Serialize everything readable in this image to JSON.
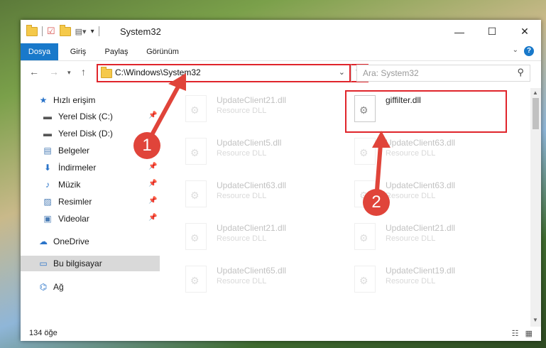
{
  "window": {
    "title": "System32"
  },
  "ribbon": {
    "tabs": [
      "Dosya",
      "Giriş",
      "Paylaş",
      "Görünüm"
    ]
  },
  "address": {
    "path": "C:\\Windows\\System32",
    "search_placeholder": "Ara: System32"
  },
  "sidebar": {
    "items": [
      {
        "label": "Hızlı erişim",
        "icon": "star-icon",
        "pinned": false
      },
      {
        "label": "Yerel Disk (C:)",
        "icon": "drive-icon",
        "pinned": true
      },
      {
        "label": "Yerel Disk (D:)",
        "icon": "drive-icon",
        "pinned": false
      },
      {
        "label": "Belgeler",
        "icon": "documents-icon",
        "pinned": true
      },
      {
        "label": "İndirmeler",
        "icon": "download-icon",
        "pinned": true
      },
      {
        "label": "Müzik",
        "icon": "music-icon",
        "pinned": true
      },
      {
        "label": "Resimler",
        "icon": "pictures-icon",
        "pinned": true
      },
      {
        "label": "Videolar",
        "icon": "videos-icon",
        "pinned": true
      },
      {
        "label": "OneDrive",
        "icon": "cloud-icon",
        "pinned": false
      },
      {
        "label": "Bu bilgisayar",
        "icon": "computer-icon",
        "pinned": false,
        "selected": true
      },
      {
        "label": "Ağ",
        "icon": "network-icon",
        "pinned": false
      }
    ]
  },
  "files": {
    "highlighted": {
      "name": "giffilter.dll"
    },
    "left_column": [
      {
        "name": "UpdateClient21.dll",
        "type": "Resource DLL"
      },
      {
        "name": "UpdateClient5.dll",
        "type": "Resource DLL"
      },
      {
        "name": "UpdateClient63.dll",
        "type": "Resource DLL"
      },
      {
        "name": "UpdateClient21.dll",
        "type": "Resource DLL"
      },
      {
        "name": "UpdateClient65.dll",
        "type": "Resource DLL"
      }
    ],
    "right_column": [
      {
        "name": "UpdateClient63.dll",
        "type": "Resource DLL"
      },
      {
        "name": "UpdateClient63.dll",
        "type": "Resource DLL"
      },
      {
        "name": "UpdateClient21.dll",
        "type": "Resource DLL"
      },
      {
        "name": "UpdateClient19.dll",
        "type": "Resource DLL"
      }
    ]
  },
  "status": {
    "item_count": "134 öğe"
  },
  "annotations": {
    "badge1": "1",
    "badge2": "2",
    "color": "#e0443a"
  }
}
